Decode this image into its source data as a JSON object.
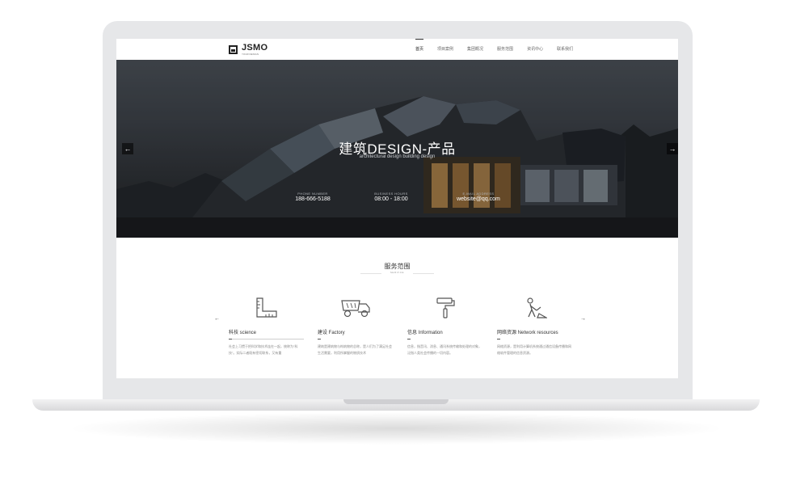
{
  "brand": {
    "name": "JSMO",
    "tagline": "YOUR DESIGN"
  },
  "nav": {
    "items": [
      {
        "label": "首页",
        "active": true
      },
      {
        "label": "项目案例",
        "active": false
      },
      {
        "label": "集团概况",
        "active": false
      },
      {
        "label": "服务范围",
        "active": false
      },
      {
        "label": "资讯中心",
        "active": false
      },
      {
        "label": "联系我们",
        "active": false
      }
    ]
  },
  "hero": {
    "title": "建筑DESIGN-产品",
    "subtitle": "architectural design building design",
    "prev_icon": "←",
    "next_icon": "→",
    "info": [
      {
        "label": "PHONE NUMBER",
        "value": "188-666-5188"
      },
      {
        "label": "BUSINESS HOURS",
        "value": "08:00 - 18:00"
      },
      {
        "label": "E-MAIL ADDRESS",
        "value": "website@qq.com"
      }
    ]
  },
  "services": {
    "title": "服务范围",
    "subtitle": "SERVICE",
    "prev_icon": "←",
    "next_icon": "→",
    "items": [
      {
        "icon": "ruler-icon",
        "name": "科技 science",
        "desc": "社会上习惯于把科学和技术连在一起，统称为“科技”。实际二者既有密切联系，又有重"
      },
      {
        "icon": "truck-icon",
        "name": "建设 Factory",
        "desc": "建筑是建筑物与构筑物的总称，是人们为了满足社会生活需要，利用所掌握的物质技术"
      },
      {
        "icon": "paint-roller-icon",
        "name": "信息 Information",
        "desc": "信息，指音讯、消息、通讯系统传输和处理的对象，泛指人类社会传播的一切内容。"
      },
      {
        "icon": "worker-icon",
        "name": "网络资源 Network resources",
        "desc": "网络资源，是利用计算机系统通过通信设备传播和网络软件管理的信息资源。"
      }
    ]
  },
  "colors": {
    "hero_dark": "#2a2d31",
    "text": "#333333",
    "accent_line": "#555555"
  }
}
